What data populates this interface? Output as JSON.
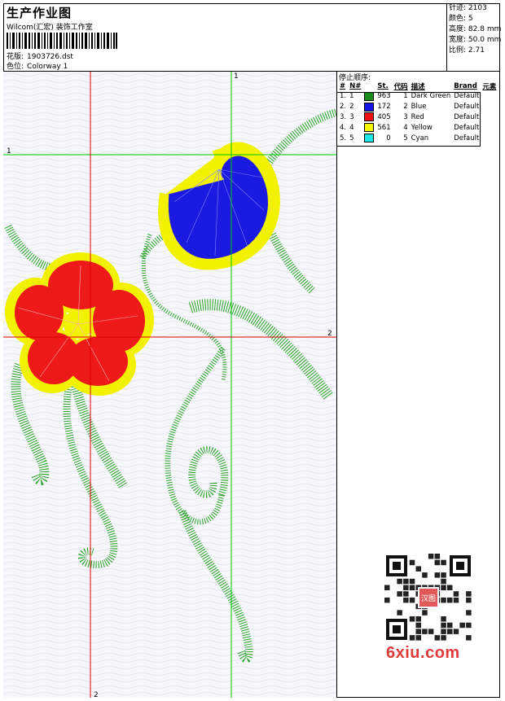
{
  "header": {
    "title": "生产作业图",
    "subtitle": "Wilcom(汇宏) 装饰工作室",
    "design_label": "花版:",
    "design_value": "1903726.dst",
    "colorway_label": "色位:",
    "colorway_value": "Colorway 1"
  },
  "stats": [
    {
      "label": "针迹:",
      "value": "2103"
    },
    {
      "label": "颜色:",
      "value": "5"
    },
    {
      "label": "高度:",
      "value": "82.8 mm"
    },
    {
      "label": "宽度:",
      "value": "50.0 mm"
    },
    {
      "label": "比例:",
      "value": "2.71"
    }
  ],
  "stop_sequence": {
    "title": "停止顺序:",
    "columns": [
      "#",
      "N#",
      "St.",
      "代码",
      "描述",
      "Brand",
      "元素"
    ],
    "rows": [
      {
        "idx": "1.",
        "n": "1",
        "color": "#1a8c1a",
        "stitches": "963",
        "code": "1",
        "desc": "Dark Green",
        "brand": "Default"
      },
      {
        "idx": "2.",
        "n": "2",
        "color": "#1414e6",
        "stitches": "172",
        "code": "2",
        "desc": "Blue",
        "brand": "Default"
      },
      {
        "idx": "3.",
        "n": "3",
        "color": "#ee1010",
        "stitches": "405",
        "code": "3",
        "desc": "Red",
        "brand": "Default"
      },
      {
        "idx": "4.",
        "n": "4",
        "color": "#f5f50a",
        "stitches": "561",
        "code": "4",
        "desc": "Yellow",
        "brand": "Default"
      },
      {
        "idx": "5.",
        "n": "5",
        "color": "#1fe6e6",
        "stitches": "0",
        "code": "5",
        "desc": "Cyan",
        "brand": "Default"
      }
    ]
  },
  "canvas": {
    "axis_labels": {
      "green_top": "1",
      "green_left": "1",
      "red_right": "2",
      "red_bottom": "2"
    },
    "line_colors": {
      "green": "#00c800",
      "red": "#e00000"
    }
  },
  "watermark": {
    "text": "6xiu.com",
    "qr_label": "汉图"
  },
  "colors": {
    "leaf": "#2aa02a",
    "petal_blue": "#1a1ae0",
    "petal_red": "#ee1a1a",
    "petal_yellow": "#f2f200"
  }
}
